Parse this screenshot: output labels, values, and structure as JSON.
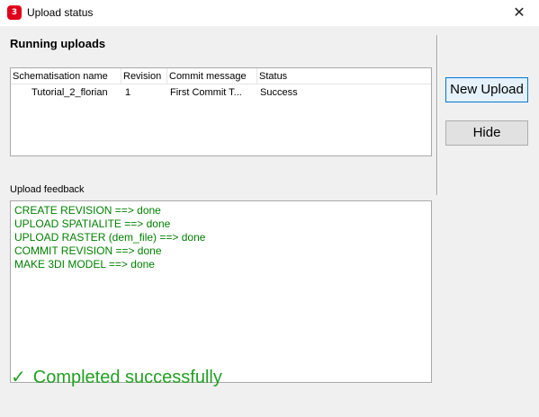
{
  "window": {
    "title": "Upload status",
    "app_icon_text": "3",
    "close_glyph": "✕"
  },
  "running": {
    "title": "Running uploads",
    "columns": [
      "Schematisation name",
      "Revision",
      "Commit message",
      "Status"
    ],
    "rows": [
      {
        "name": "Tutorial_2_florian",
        "revision": "1",
        "message": "First Commit T...",
        "status": "Success"
      }
    ]
  },
  "buttons": {
    "new_upload": "New Upload",
    "hide": "Hide"
  },
  "feedback": {
    "label": "Upload feedback",
    "lines": [
      "CREATE REVISION ==> done",
      "UPLOAD SPATIALITE ==> done",
      "UPLOAD RASTER (dem_file) ==> done",
      "COMMIT REVISION ==> done",
      "MAKE 3DI MODEL ==> done"
    ]
  },
  "status": {
    "check_glyph": "✓",
    "message": "Completed successfully",
    "color": "#22a022"
  }
}
